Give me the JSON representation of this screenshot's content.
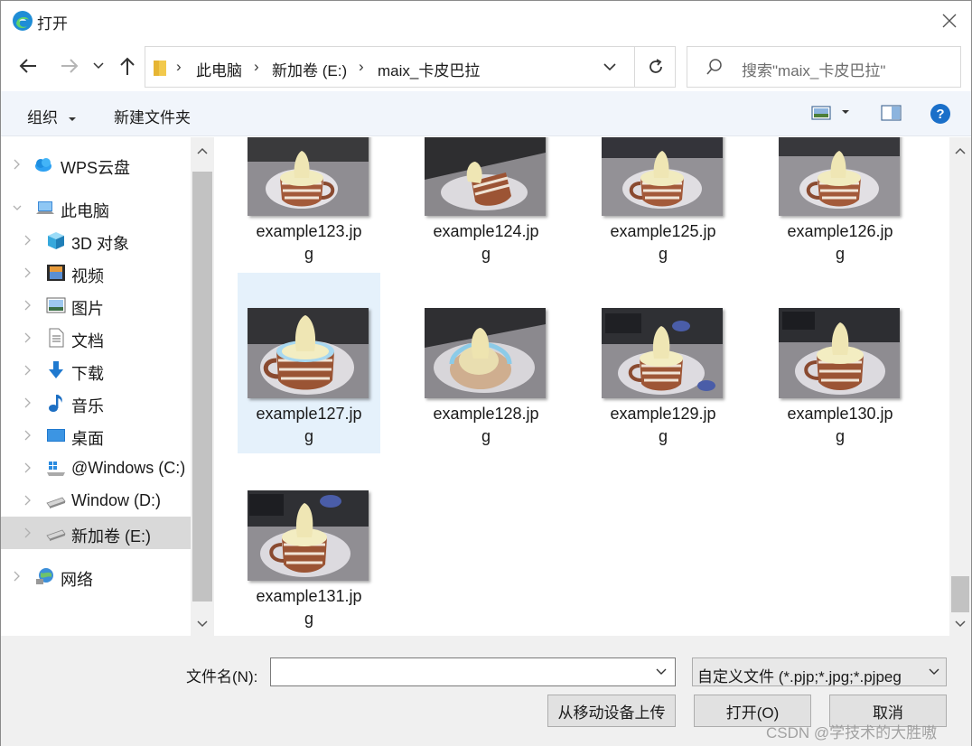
{
  "window": {
    "title": "打开"
  },
  "address": {
    "crumbs": [
      "此电脑",
      "新加卷 (E:)",
      "maix_卡皮巴拉"
    ],
    "separator": "›"
  },
  "search": {
    "placeholder": "搜索\"maix_卡皮巴拉\""
  },
  "toolbar": {
    "organize_label": "组织",
    "new_folder_label": "新建文件夹"
  },
  "sidebar": {
    "items": [
      {
        "label": "WPS云盘",
        "icon": "cloud-icon"
      },
      {
        "label": "此电脑",
        "icon": "computer-icon"
      },
      {
        "label": "3D 对象",
        "icon": "3d-objects-icon"
      },
      {
        "label": "视频",
        "icon": "video-icon"
      },
      {
        "label": "图片",
        "icon": "pictures-icon"
      },
      {
        "label": "文档",
        "icon": "documents-icon"
      },
      {
        "label": "下载",
        "icon": "download-icon"
      },
      {
        "label": "音乐",
        "icon": "music-icon"
      },
      {
        "label": "桌面",
        "icon": "desktop-icon"
      },
      {
        "label": "@Windows (C:)",
        "icon": "windows-drive-icon"
      },
      {
        "label": "Window (D:)",
        "icon": "drive-icon"
      },
      {
        "label": "新加卷 (E:)",
        "icon": "drive-icon",
        "selected": true
      },
      {
        "label": "网络",
        "icon": "network-icon"
      }
    ]
  },
  "files": [
    {
      "name_line1": "example123.jp",
      "name_line2": "g"
    },
    {
      "name_line1": "example124.jp",
      "name_line2": "g"
    },
    {
      "name_line1": "example125.jp",
      "name_line2": "g"
    },
    {
      "name_line1": "example126.jp",
      "name_line2": "g"
    },
    {
      "name_line1": "example127.jp",
      "name_line2": "g",
      "selected": true
    },
    {
      "name_line1": "example128.jp",
      "name_line2": "g"
    },
    {
      "name_line1": "example129.jp",
      "name_line2": "g"
    },
    {
      "name_line1": "example130.jp",
      "name_line2": "g"
    },
    {
      "name_line1": "example131.jp",
      "name_line2": "g"
    }
  ],
  "footer": {
    "filename_label": "文件名(N):",
    "filename_value": "",
    "filetype_label": "自定义文件 (*.pjp;*.jpg;*.pjpeg",
    "upload_button": "从移动设备上传",
    "open_button": "打开(O)",
    "cancel_button": "取消",
    "watermark": "CSDN @学技术的大胜嗷"
  },
  "colors": {
    "selection": "#e5f1fb",
    "sidebar_selected": "#d9d9d9",
    "help": "#1a6fc9",
    "accent": "#0078d7"
  }
}
